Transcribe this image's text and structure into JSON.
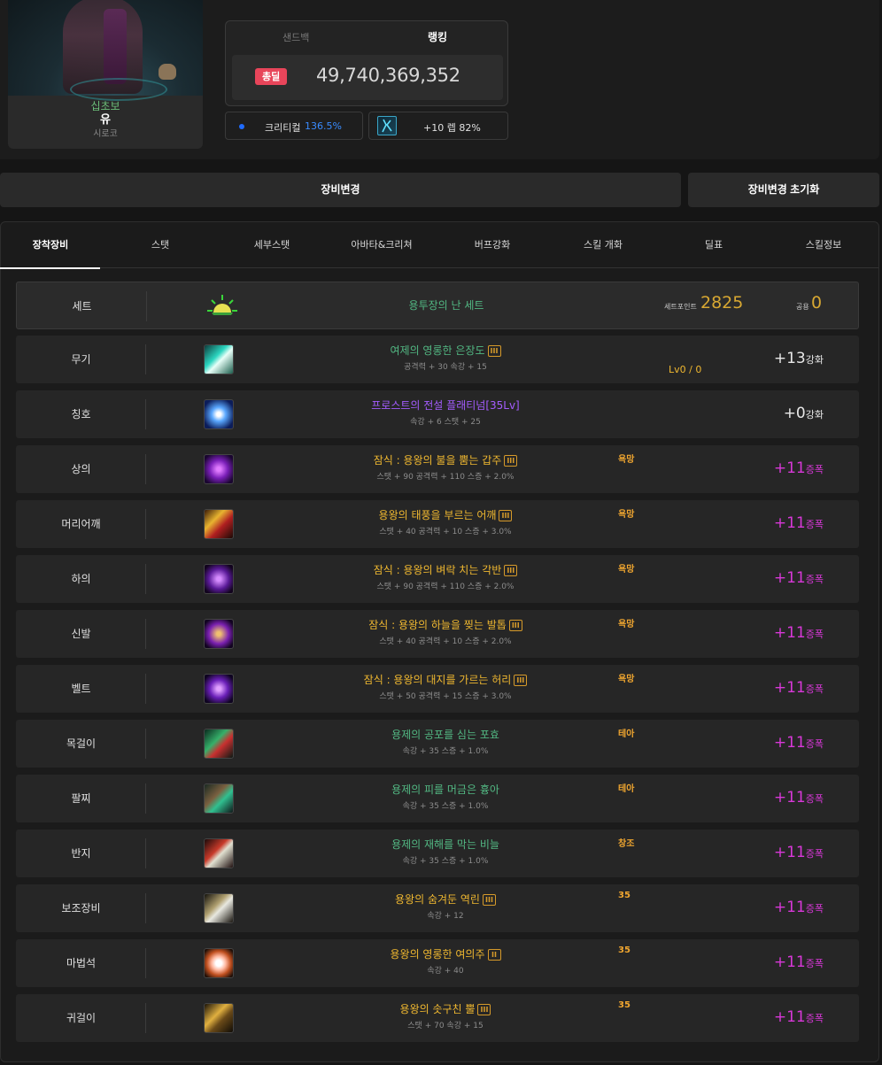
{
  "character": {
    "adventure": "십초보",
    "name": "유",
    "server": "시로코"
  },
  "ranking": {
    "tab_sandbag": "샌드백",
    "tab_ranking": "랭킹",
    "total_label": "총딜",
    "total_value": "49,740,369,352"
  },
  "crit": {
    "label": "크리티컬",
    "value": "136.5%"
  },
  "buff": {
    "value": "+10 렙 82%"
  },
  "buttons": {
    "change": "장비변경",
    "reset": "장비변경 초기화"
  },
  "tabs": [
    "장착장비",
    "스탯",
    "세부스탯",
    "아바타&크리쳐",
    "버프강화",
    "스킬 개화",
    "딜표",
    "스킬정보"
  ],
  "set_row": {
    "slot": "세트",
    "name": "용투장의 난 세트",
    "point_label": "세트포인트",
    "point_value": "2825",
    "share_label": "공용",
    "share_value": "0"
  },
  "equipment": [
    {
      "slot": "무기",
      "name": "여제의 영롱한 은장도",
      "grade": "III",
      "stat": "공격력 + 30 속강 + 15",
      "tag": "",
      "lv": "Lv0 / 0",
      "enh_num": "+13",
      "enh_unit": "강화",
      "name_color": "#52b883",
      "enh_color": "#e8e8e8"
    },
    {
      "slot": "칭호",
      "name": "프로스트의 전설 플래티넘[35Lv]",
      "grade": "",
      "stat": "속강 + 6 스탯 + 25",
      "tag": "",
      "lv": "",
      "enh_num": "+0",
      "enh_unit": "강화",
      "name_color": "#a45cff",
      "enh_color": "#e8e8e8"
    },
    {
      "slot": "상의",
      "name": "잠식 : 용왕의 불을 뿜는 갑주",
      "grade": "III",
      "stat": "스탯 + 90 공격력 + 110 스증 + 2.0%",
      "tag": "욕망",
      "lv": "",
      "enh_num": "+11",
      "enh_unit": "증폭",
      "name_color": "#f0b830",
      "enh_color": "#d838d8"
    },
    {
      "slot": "머리어깨",
      "name": "용왕의 태풍을 부르는 어깨",
      "grade": "III",
      "stat": "스탯 + 40 공격력 + 10 스증 + 3.0%",
      "tag": "욕망",
      "lv": "",
      "enh_num": "+11",
      "enh_unit": "증폭",
      "name_color": "#f0b830",
      "enh_color": "#d838d8"
    },
    {
      "slot": "하의",
      "name": "잠식 : 용왕의 벼락 치는 각반",
      "grade": "III",
      "stat": "스탯 + 90 공격력 + 110 스증 + 2.0%",
      "tag": "욕망",
      "lv": "",
      "enh_num": "+11",
      "enh_unit": "증폭",
      "name_color": "#f0b830",
      "enh_color": "#d838d8"
    },
    {
      "slot": "신발",
      "name": "잠식 : 용왕의 하늘을 찢는 발톱",
      "grade": "III",
      "stat": "스탯 + 40 공격력 + 10 스증 + 2.0%",
      "tag": "욕망",
      "lv": "",
      "enh_num": "+11",
      "enh_unit": "증폭",
      "name_color": "#f0b830",
      "enh_color": "#d838d8"
    },
    {
      "slot": "벨트",
      "name": "잠식 : 용왕의 대지를 가르는 허리",
      "grade": "III",
      "stat": "스탯 + 50 공격력 + 15 스증 + 3.0%",
      "tag": "욕망",
      "lv": "",
      "enh_num": "+11",
      "enh_unit": "증폭",
      "name_color": "#f0b830",
      "enh_color": "#d838d8"
    },
    {
      "slot": "목걸이",
      "name": "용제의 공포를 심는 포효",
      "grade": "",
      "stat": "속강 + 35 스증 + 1.0%",
      "tag": "테아",
      "lv": "",
      "enh_num": "+11",
      "enh_unit": "증폭",
      "name_color": "#52b883",
      "enh_color": "#d838d8"
    },
    {
      "slot": "팔찌",
      "name": "용제의 피를 머금은 흉아",
      "grade": "",
      "stat": "속강 + 35 스증 + 1.0%",
      "tag": "테아",
      "lv": "",
      "enh_num": "+11",
      "enh_unit": "증폭",
      "name_color": "#52b883",
      "enh_color": "#d838d8"
    },
    {
      "slot": "반지",
      "name": "용제의 재해를 막는 비늘",
      "grade": "",
      "stat": "속강 + 35 스증 + 1.0%",
      "tag": "창조",
      "lv": "",
      "enh_num": "+11",
      "enh_unit": "증폭",
      "name_color": "#52b883",
      "enh_color": "#d838d8"
    },
    {
      "slot": "보조장비",
      "name": "용왕의 숨겨둔 역린",
      "grade": "III",
      "stat": "속강 + 12",
      "tag": "35",
      "lv": "",
      "enh_num": "+11",
      "enh_unit": "증폭",
      "name_color": "#f0b830",
      "enh_color": "#d838d8"
    },
    {
      "slot": "마법석",
      "name": "용왕의 영롱한 여의주",
      "grade": "II",
      "stat": "속강 + 40",
      "tag": "35",
      "lv": "",
      "enh_num": "+11",
      "enh_unit": "증폭",
      "name_color": "#f0b830",
      "enh_color": "#d838d8"
    },
    {
      "slot": "귀걸이",
      "name": "용왕의 솟구친 뿔",
      "grade": "III",
      "stat": "스탯 + 70 속강 + 15",
      "tag": "35",
      "lv": "",
      "enh_num": "+11",
      "enh_unit": "증폭",
      "name_color": "#f0b830",
      "enh_color": "#d838d8"
    }
  ],
  "icons": [
    "weapon-sword-icon",
    "title-ice-icon",
    "top-armor-icon",
    "shoulder-armor-icon",
    "pants-armor-icon",
    "shoes-armor-icon",
    "belt-armor-icon",
    "necklace-icon",
    "bracelet-icon",
    "ring-icon",
    "support-equip-icon",
    "magic-stone-icon",
    "earring-icon"
  ],
  "colors": {
    "accent_gold": "#f0b830",
    "green": "#52b883",
    "purple": "#a45cff",
    "magenta": "#d838d8",
    "badge_red": "#e8455a",
    "crit_blue": "#3a8cff"
  }
}
